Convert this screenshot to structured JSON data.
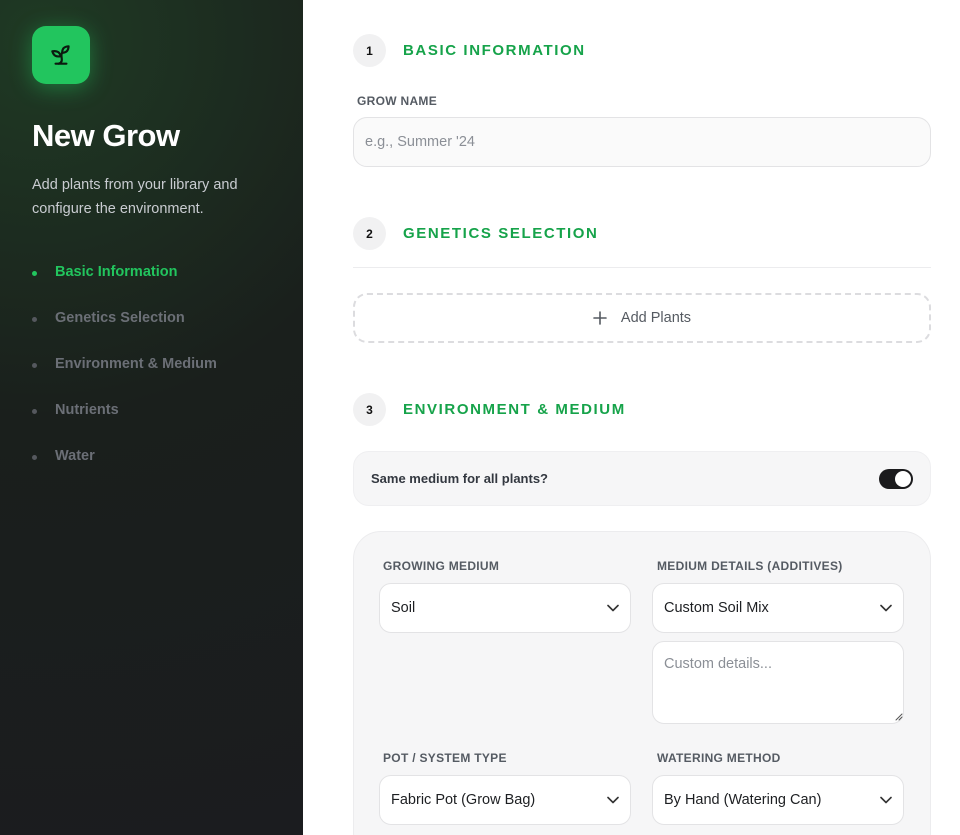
{
  "sidebar": {
    "logo_icon": "sprout-icon",
    "title": "New Grow",
    "description": "Add plants from your library and configure the environment.",
    "steps": [
      {
        "label": "Basic Information",
        "active": true
      },
      {
        "label": "Genetics Selection",
        "active": false
      },
      {
        "label": "Environment & Medium",
        "active": false
      },
      {
        "label": "Nutrients",
        "active": false
      },
      {
        "label": "Water",
        "active": false
      }
    ]
  },
  "sections": {
    "basic": {
      "number": "1",
      "title": "BASIC INFORMATION",
      "grow_name_label": "GROW NAME",
      "grow_name_value": "",
      "grow_name_placeholder": "e.g., Summer '24"
    },
    "genetics": {
      "number": "2",
      "title": "GENETICS SELECTION",
      "add_plants_label": "Add Plants"
    },
    "environment": {
      "number": "3",
      "title": "ENVIRONMENT & MEDIUM",
      "same_medium_label": "Same medium for all plants?",
      "same_medium_on": true,
      "growing_medium_label": "GROWING MEDIUM",
      "growing_medium_value": "Soil",
      "medium_details_label": "MEDIUM DETAILS (ADDITIVES)",
      "medium_details_value": "Custom Soil Mix",
      "custom_details_placeholder": "Custom details...",
      "pot_type_label": "POT / SYSTEM TYPE",
      "pot_type_value": "Fabric Pot (Grow Bag)",
      "watering_method_label": "WATERING METHOD",
      "watering_method_value": "By Hand (Watering Can)"
    }
  },
  "colors": {
    "accent": "#22c55e",
    "accent_text": "#16a34a",
    "sidebar_bg": "#1b1c1f"
  }
}
